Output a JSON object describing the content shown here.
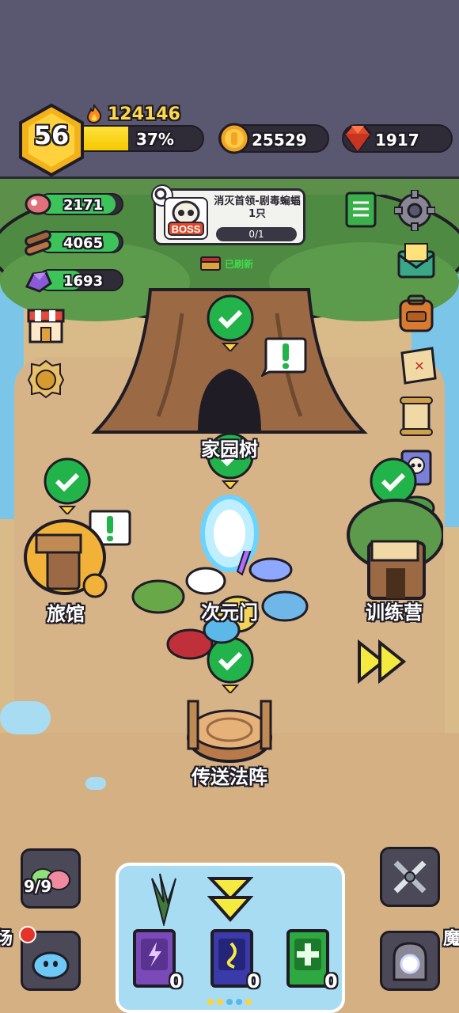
{
  "hud": {
    "level": "56",
    "power": "124146",
    "xp_percent": "37%",
    "xp_fraction": 0.37,
    "gold": "25529",
    "gems": "1917"
  },
  "resources": {
    "meat": "2171",
    "wood": "4065",
    "ore": "1693"
  },
  "quest": {
    "badge": "BOSS",
    "title": "消灭首领-剧毒蝙蝠1只",
    "progress": "0/1",
    "refresh_text": "已刷新"
  },
  "places": {
    "tree": "家园树",
    "inn": "旅馆",
    "portal": "次元门",
    "training": "训练营",
    "teleport": "传送法阵"
  },
  "bottom": {
    "slime_count": "9/9",
    "book_purple_count": "0",
    "book_blue_count": "0",
    "book_green_count": "0",
    "left_edge_label": "场",
    "right_edge_label": "魔"
  },
  "colors": {
    "hud_bg": "#5a5770",
    "gold_accent": "#ffd84a",
    "xp_fill": "#f5c800",
    "resource_fill": "#3cc45a",
    "check_green": "#22b34a",
    "gem_red": "#e24a2c",
    "sea": "#7bc6e8",
    "ground": "#d6b488"
  },
  "icons": {
    "power": "flame-icon",
    "gold": "gold-coin-icon",
    "gems": "red-gem-icon",
    "meat": "meat-icon",
    "wood": "wood-logs-icon",
    "ore": "purple-ore-icon",
    "settings": "gear-icon",
    "codex": "green-book-icon",
    "mail": "mail-icon",
    "bag": "backpack-icon",
    "map": "treasure-map-icon",
    "scroll": "scroll-icon",
    "card": "skull-card-icon",
    "hut": "hut-icon",
    "shop": "shop-icon",
    "rank": "crown-medal-icon",
    "fast_forward": "fast-forward-icon"
  }
}
